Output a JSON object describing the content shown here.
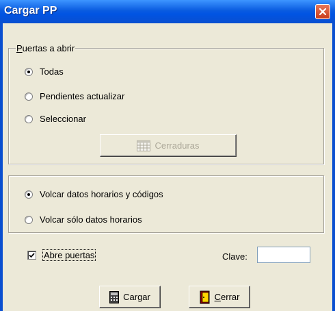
{
  "window": {
    "title": "Cargar PP"
  },
  "puertas_group": {
    "legend": "Puertas a abrir",
    "options": [
      {
        "label": "Todas",
        "checked": true
      },
      {
        "label": "Pendientes actualizar",
        "checked": false
      },
      {
        "label": "Seleccionar",
        "checked": false
      }
    ],
    "cerraduras_button": "Cerraduras"
  },
  "volcar_group": {
    "options": [
      {
        "label": "Volcar datos horarios y códigos",
        "checked": true
      },
      {
        "label": "Volcar sólo datos horarios",
        "checked": false
      }
    ]
  },
  "abre_puertas": {
    "label": "Abre puertas",
    "checked": true
  },
  "clave": {
    "label": "Clave:",
    "value": ""
  },
  "buttons": {
    "cargar": "Cargar",
    "cerrar": "Cerrar"
  },
  "colors": {
    "titlebar": "#0054e3",
    "dialog_bg": "#ece9d8",
    "close_button": "#c93b1b"
  }
}
